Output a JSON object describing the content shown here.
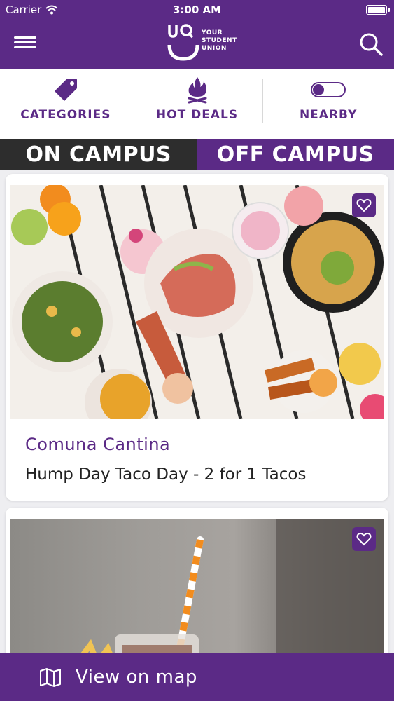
{
  "status_bar": {
    "carrier": "Carrier",
    "time": "3:00 AM",
    "battery_level": 1.0
  },
  "header": {
    "logo_text": [
      "YOUR",
      "STUDENT",
      "UNION"
    ],
    "menu_icon": "hamburger-icon",
    "search_icon": "search-icon"
  },
  "filters": [
    {
      "label": "CATEGORIES",
      "icon": "tag-icon"
    },
    {
      "label": "HOT DEALS",
      "icon": "flame-icon"
    },
    {
      "label": "NEARBY",
      "icon": "toggle-icon"
    }
  ],
  "tabs": {
    "on_campus": "ON CAMPUS",
    "off_campus": "OFF CAMPUS",
    "selected": "off_campus"
  },
  "deals": [
    {
      "venue": "Comuna Cantina",
      "title": "Hump Day Taco Day - 2 for 1 Tacos",
      "image": "food-spread-photo",
      "favorite_icon": "heart-icon"
    },
    {
      "image": "milkshake-photo",
      "favorite_icon": "heart-icon"
    }
  ],
  "map_bar": {
    "label": "View on map",
    "icon": "map-icon"
  },
  "colors": {
    "brand": "#5b2a86",
    "dark_tab": "#2d2d2d",
    "background": "#eeeef1"
  }
}
